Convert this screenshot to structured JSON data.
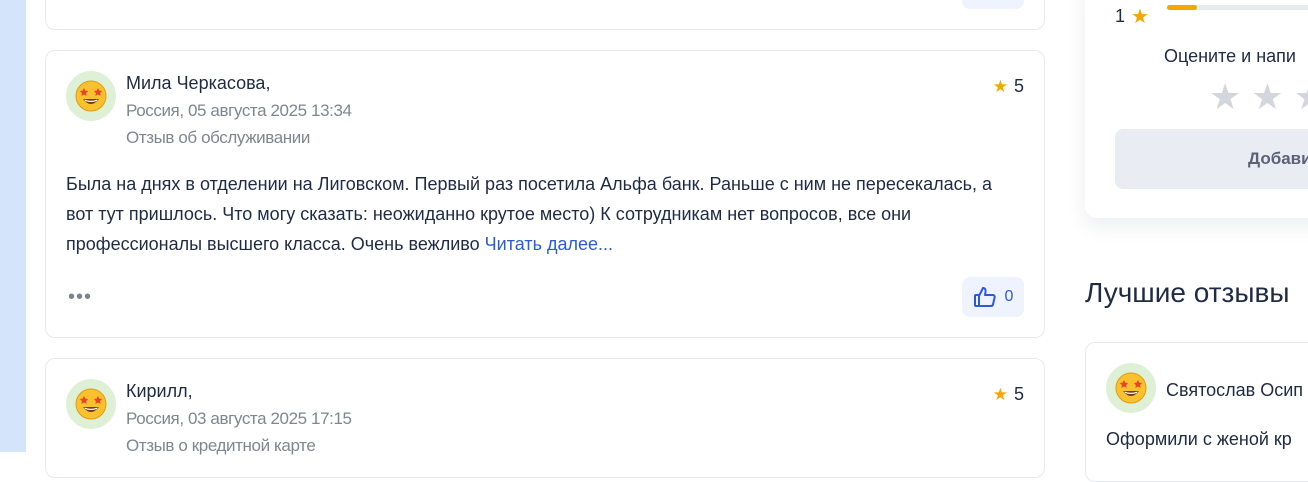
{
  "reviews": [
    {
      "author": "Мила Черкасова,",
      "date": "Россия, 05 августа 2025 13:34",
      "type": "Отзыв об обслуживании",
      "rating": "5",
      "text": "Была на днях в отделении на Лиговском. Первый раз посетила Альфа банк. Раньше с ним не пересекалась, а вот тут пришлось. Что могу сказать: неожиданно крутое место) К сотрудникам нет вопросов, все они профессионалы высшего класса. Очень вежливо",
      "read_more": "Читать далее...",
      "more": "•••",
      "likes": "0"
    },
    {
      "author": "Кирилл,",
      "date": "Россия, 03 августа 2025 17:15",
      "type": "Отзыв о кредитной карте",
      "rating": "5"
    }
  ],
  "sidebar_rating": {
    "row_label": "1",
    "row_fill": 0.15,
    "prompt": "Оцените и напи",
    "add_button": "Добави"
  },
  "best": {
    "title": "Лучшие отзывы",
    "author": "Святослав Осип",
    "text": "Оформили с женой кр"
  },
  "icons": {
    "avatar": "star-struck-emoji",
    "star": "star-icon",
    "like": "thumbs-up-icon"
  },
  "colors": {
    "accent": "#2a5bd7",
    "star": "#f7a600",
    "like_bg": "#eef3fd",
    "left_strip": "#d3e4fb"
  }
}
